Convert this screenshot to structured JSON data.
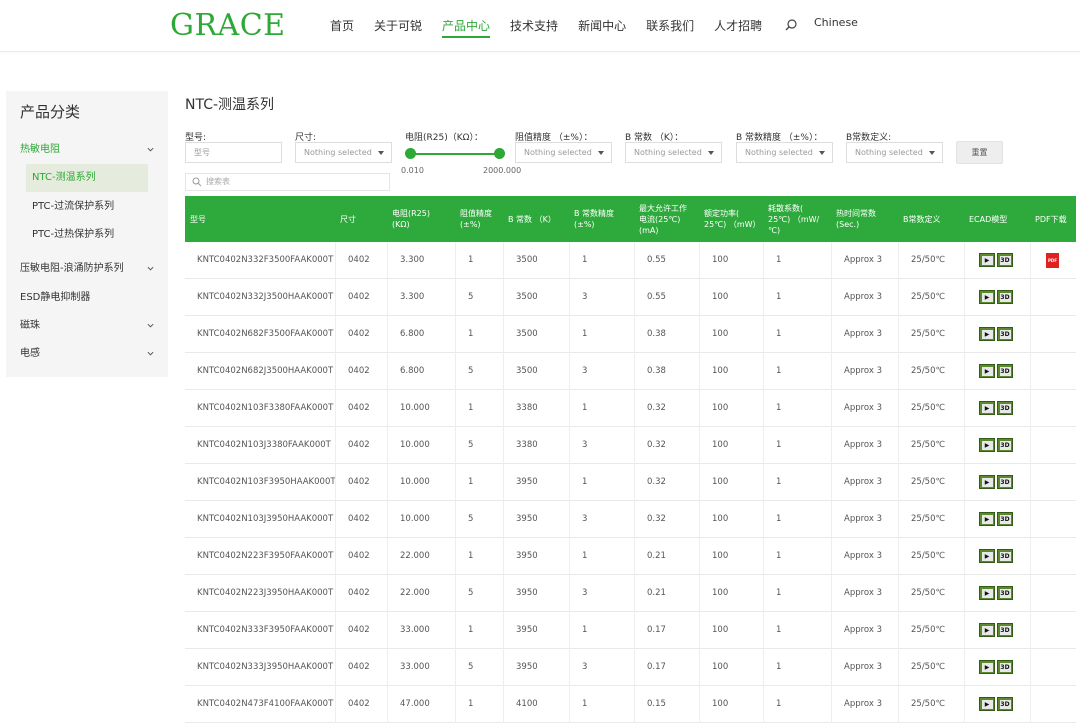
{
  "header": {
    "logo": "GRACE",
    "nav": [
      "首页",
      "关于可锐",
      "产品中心",
      "技术支持",
      "新闻中心",
      "联系我们",
      "人才招聘"
    ],
    "active_index": 2,
    "lang": "Chinese",
    "accent": "#2ea836"
  },
  "sidebar": {
    "title": "产品分类",
    "items": [
      {
        "label": "热敏电阻",
        "expandable": true,
        "green": true
      },
      {
        "label": "NTC-测温系列",
        "sub": true,
        "active": true
      },
      {
        "label": "PTC-过流保护系列",
        "sub": true
      },
      {
        "label": "PTC-过热保护系列",
        "sub": true
      },
      {
        "label": "压敏电阻-浪涌防护系列",
        "expandable": true
      },
      {
        "label": "ESD静电抑制器",
        "expandable": false
      },
      {
        "label": "磁珠",
        "expandable": true
      },
      {
        "label": "电感",
        "expandable": true
      }
    ]
  },
  "main": {
    "title": "NTC-测温系列",
    "filters": {
      "model_label": "型号:",
      "model_placeholder": "型号",
      "size_label": "尺寸:",
      "resistance_label": "电阻(R25)（KΩ）：",
      "tolerance_label": "阻值精度 （±%）：",
      "b_label": "B 常数 （K）：",
      "b_tol_label": "B 常数精度 （±%）：",
      "b_def_label": "B常数定义:",
      "nothing_selected": "Nothing selected",
      "slider_min": "0.010",
      "slider_max": "2000.000",
      "reset": "重置"
    },
    "search_placeholder": "搜索表"
  },
  "table": {
    "headers": [
      "型号",
      "尺寸",
      "电阻(R25)\n(KΩ)",
      "阻值精度\n(±%)",
      "B 常数 （K）",
      "B 常数精度\n(±%)",
      "最大允许工作\n电流(25℃)\n(mA)",
      "额定功率(\n25℃) （mW）",
      "耗散系数(\n25℃) （mW/\n℃)",
      "热时间常数\n(Sec.)",
      "B常数定义",
      "ECAD模型",
      "PDF下载"
    ],
    "ecad_label": "3D",
    "pdf_label": "PDF",
    "rows": [
      [
        "KNTC0402N332F3500FAAK000T",
        "0402",
        "3.300",
        "1",
        "3500",
        "1",
        "0.55",
        "100",
        "1",
        "Approx 3",
        "25/50℃"
      ],
      [
        "KNTC0402N332J3500HAAK000T",
        "0402",
        "3.300",
        "5",
        "3500",
        "3",
        "0.55",
        "100",
        "1",
        "Approx 3",
        "25/50℃"
      ],
      [
        "KNTC0402N682F3500FAAK000T",
        "0402",
        "6.800",
        "1",
        "3500",
        "1",
        "0.38",
        "100",
        "1",
        "Approx 3",
        "25/50℃"
      ],
      [
        "KNTC0402N682J3500HAAK000T",
        "0402",
        "6.800",
        "5",
        "3500",
        "3",
        "0.38",
        "100",
        "1",
        "Approx 3",
        "25/50℃"
      ],
      [
        "KNTC0402N103F3380FAAK000T",
        "0402",
        "10.000",
        "1",
        "3380",
        "1",
        "0.32",
        "100",
        "1",
        "Approx 3",
        "25/50℃"
      ],
      [
        "KNTC0402N103J3380FAAK000T",
        "0402",
        "10.000",
        "5",
        "3380",
        "3",
        "0.32",
        "100",
        "1",
        "Approx 3",
        "25/50℃"
      ],
      [
        "KNTC0402N103F3950HAAK000T",
        "0402",
        "10.000",
        "1",
        "3950",
        "1",
        "0.32",
        "100",
        "1",
        "Approx 3",
        "25/50℃"
      ],
      [
        "KNTC0402N103J3950HAAK000T",
        "0402",
        "10.000",
        "5",
        "3950",
        "3",
        "0.32",
        "100",
        "1",
        "Approx 3",
        "25/50℃"
      ],
      [
        "KNTC0402N223F3950FAAK000T",
        "0402",
        "22.000",
        "1",
        "3950",
        "1",
        "0.21",
        "100",
        "1",
        "Approx 3",
        "25/50℃"
      ],
      [
        "KNTC0402N223J3950HAAK000T",
        "0402",
        "22.000",
        "5",
        "3950",
        "3",
        "0.21",
        "100",
        "1",
        "Approx 3",
        "25/50℃"
      ],
      [
        "KNTC0402N333F3950FAAK000T",
        "0402",
        "33.000",
        "1",
        "3950",
        "1",
        "0.17",
        "100",
        "1",
        "Approx 3",
        "25/50℃"
      ],
      [
        "KNTC0402N333J3950HAAK000T",
        "0402",
        "33.000",
        "5",
        "3950",
        "3",
        "0.17",
        "100",
        "1",
        "Approx 3",
        "25/50℃"
      ],
      [
        "KNTC0402N473F4100FAAK000T",
        "0402",
        "47.000",
        "1",
        "4100",
        "1",
        "0.15",
        "100",
        "1",
        "Approx 3",
        "25/50℃"
      ]
    ]
  }
}
